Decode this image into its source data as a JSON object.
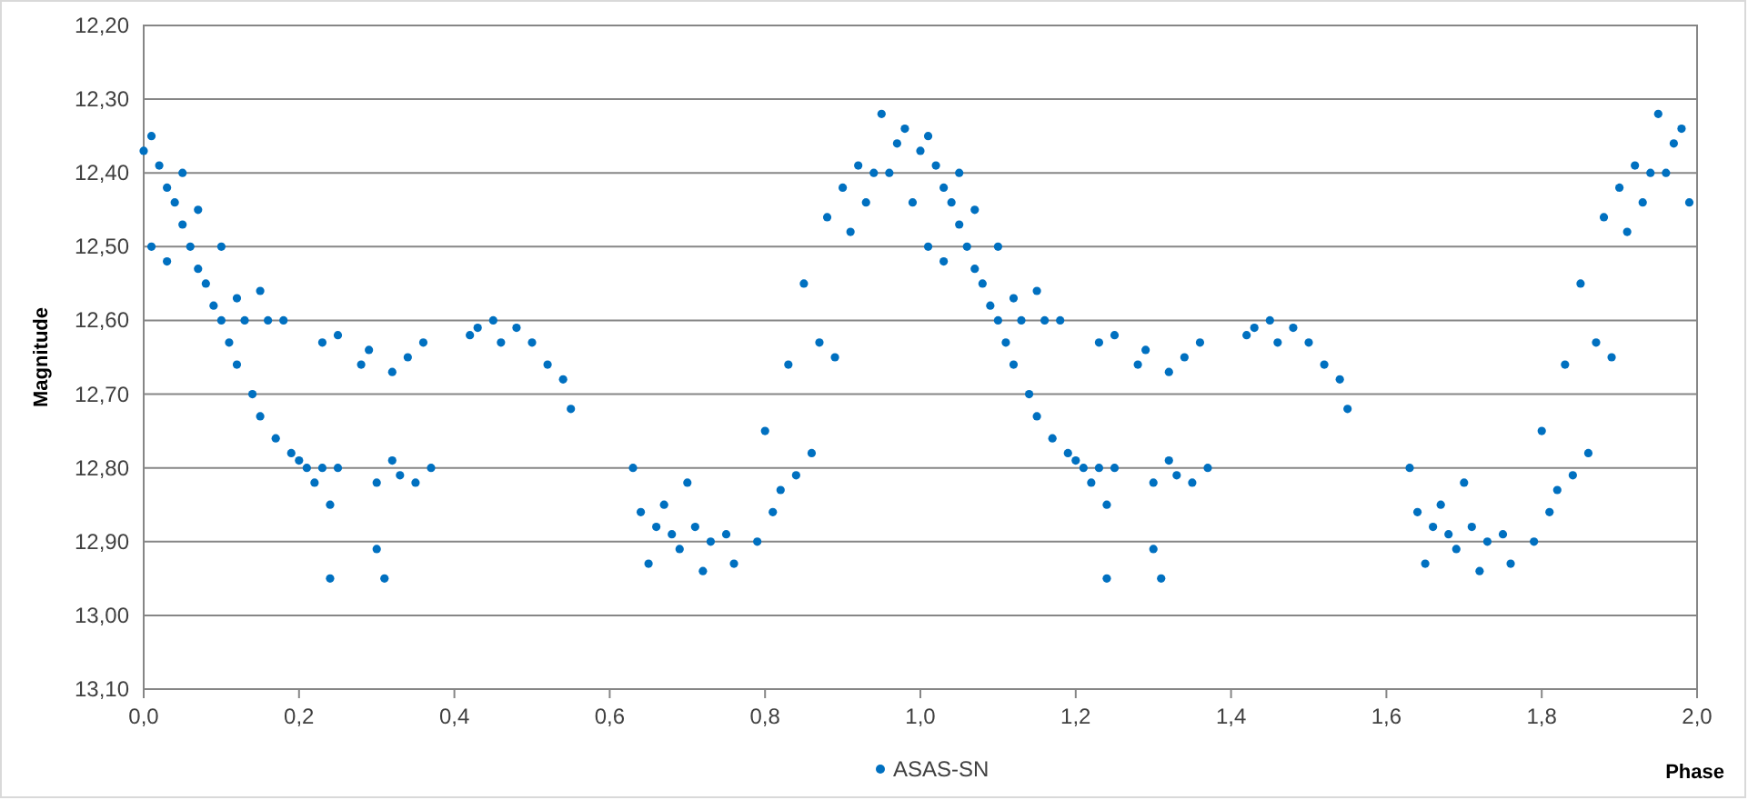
{
  "chart_data": {
    "type": "scatter",
    "grid": "y",
    "xlabel": "Phase",
    "ylabel": "Magnitude",
    "xlim": [
      0,
      2
    ],
    "ylim": [
      13.1,
      12.2
    ],
    "xticks": [
      {
        "value": 0,
        "label": "0,0"
      },
      {
        "value": 0.2,
        "label": "0,2"
      },
      {
        "value": 0.4,
        "label": "0,4"
      },
      {
        "value": 0.6,
        "label": "0,6"
      },
      {
        "value": 0.8,
        "label": "0,8"
      },
      {
        "value": 1,
        "label": "1,0"
      },
      {
        "value": 1.2,
        "label": "1,2"
      },
      {
        "value": 1.4,
        "label": "1,4"
      },
      {
        "value": 1.6,
        "label": "1,6"
      },
      {
        "value": 1.8,
        "label": "1,8"
      },
      {
        "value": 2,
        "label": "2,0"
      }
    ],
    "yticks": [
      {
        "value": 12.2,
        "label": "12,20"
      },
      {
        "value": 12.3,
        "label": "12,30"
      },
      {
        "value": 12.4,
        "label": "12,40"
      },
      {
        "value": 12.5,
        "label": "12,50"
      },
      {
        "value": 12.6,
        "label": "12,60"
      },
      {
        "value": 12.7,
        "label": "12,70"
      },
      {
        "value": 12.8,
        "label": "12,80"
      },
      {
        "value": 12.9,
        "label": "12,90"
      },
      {
        "value": 13,
        "label": "13,00"
      },
      {
        "value": 13.1,
        "label": "13,10"
      }
    ],
    "x": [
      0,
      0.01,
      0.01,
      0.02,
      0.03,
      0.03,
      0.04,
      0.05,
      0.05,
      0.06,
      0.07,
      0.07,
      0.08,
      0.09,
      0.1,
      0.1,
      0.11,
      0.12,
      0.12,
      0.13,
      0.14,
      0.15,
      0.15,
      0.16,
      0.17,
      0.18,
      0.19,
      0.2,
      0.21,
      0.22,
      0.23,
      0.23,
      0.24,
      0.24,
      0.25,
      0.25,
      0.28,
      0.29,
      0.3,
      0.3,
      0.31,
      0.32,
      0.32,
      0.33,
      0.34,
      0.35,
      0.36,
      0.37,
      0.42,
      0.43,
      0.45,
      0.46,
      0.48,
      0.5,
      0.52,
      0.54,
      0.55,
      0.63,
      0.64,
      0.65,
      0.66,
      0.67,
      0.68,
      0.69,
      0.7,
      0.71,
      0.72,
      0.73,
      0.75,
      0.76,
      0.79,
      0.8,
      0.81,
      0.82,
      0.83,
      0.84,
      0.85,
      0.86,
      0.87,
      0.88,
      0.89,
      0.9,
      0.91,
      0.92,
      0.93,
      0.94,
      0.95,
      0.96,
      0.97,
      0.98,
      0.99,
      1,
      1.01,
      1.01,
      1.02,
      1.03,
      1.03,
      1.04,
      1.05,
      1.05,
      1.06,
      1.07,
      1.07,
      1.08,
      1.09,
      1.1,
      1.1,
      1.11,
      1.12,
      1.12,
      1.13,
      1.14,
      1.15,
      1.15,
      1.16,
      1.17,
      1.18,
      1.19,
      1.2,
      1.21,
      1.22,
      1.23,
      1.23,
      1.24,
      1.24,
      1.25,
      1.25,
      1.28,
      1.29,
      1.3,
      1.3,
      1.31,
      1.32,
      1.32,
      1.33,
      1.34,
      1.35,
      1.36,
      1.37,
      1.42,
      1.43,
      1.45,
      1.46,
      1.48,
      1.5,
      1.52,
      1.54,
      1.55,
      1.63,
      1.64,
      1.65,
      1.66,
      1.67,
      1.68,
      1.69,
      1.7,
      1.71,
      1.72,
      1.73,
      1.75,
      1.76,
      1.79,
      1.8,
      1.81,
      1.82,
      1.83,
      1.84,
      1.85,
      1.86,
      1.87,
      1.88,
      1.89,
      1.9,
      1.91,
      1.92,
      1.93,
      1.94,
      1.95,
      1.96,
      1.97,
      1.98,
      1.99
    ],
    "series": [
      {
        "name": "ASAS-SN",
        "color": "#0070c0",
        "values": [
          12.37,
          12.35,
          12.5,
          12.39,
          12.42,
          12.52,
          12.44,
          12.47,
          12.4,
          12.5,
          12.53,
          12.45,
          12.55,
          12.58,
          12.6,
          12.5,
          12.63,
          12.66,
          12.57,
          12.6,
          12.7,
          12.73,
          12.56,
          12.6,
          12.76,
          12.6,
          12.78,
          12.79,
          12.8,
          12.82,
          12.8,
          12.63,
          12.85,
          12.95,
          12.8,
          12.62,
          12.66,
          12.64,
          12.82,
          12.91,
          12.95,
          12.67,
          12.79,
          12.81,
          12.65,
          12.82,
          12.63,
          12.8,
          12.62,
          12.61,
          12.6,
          12.63,
          12.61,
          12.63,
          12.66,
          12.68,
          12.72,
          12.8,
          12.86,
          12.93,
          12.88,
          12.85,
          12.89,
          12.91,
          12.82,
          12.88,
          12.94,
          12.9,
          12.89,
          12.93,
          12.9,
          12.75,
          12.86,
          12.83,
          12.66,
          12.81,
          12.55,
          12.78,
          12.63,
          12.46,
          12.65,
          12.42,
          12.48,
          12.39,
          12.44,
          12.4,
          12.32,
          12.4,
          12.36,
          12.34,
          12.44,
          12.37,
          12.35,
          12.5,
          12.39,
          12.42,
          12.52,
          12.44,
          12.47,
          12.4,
          12.5,
          12.53,
          12.45,
          12.55,
          12.58,
          12.6,
          12.5,
          12.63,
          12.66,
          12.57,
          12.6,
          12.7,
          12.73,
          12.56,
          12.6,
          12.76,
          12.6,
          12.78,
          12.79,
          12.8,
          12.82,
          12.8,
          12.63,
          12.85,
          12.95,
          12.8,
          12.62,
          12.66,
          12.64,
          12.82,
          12.91,
          12.95,
          12.67,
          12.79,
          12.81,
          12.65,
          12.82,
          12.63,
          12.8,
          12.62,
          12.61,
          12.6,
          12.63,
          12.61,
          12.63,
          12.66,
          12.68,
          12.72,
          12.8,
          12.86,
          12.93,
          12.88,
          12.85,
          12.89,
          12.91,
          12.82,
          12.88,
          12.94,
          12.9,
          12.89,
          12.93,
          12.9,
          12.75,
          12.86,
          12.83,
          12.66,
          12.81,
          12.55,
          12.78,
          12.63,
          12.46,
          12.65,
          12.42,
          12.48,
          12.39,
          12.44,
          12.4,
          12.32,
          12.4,
          12.36,
          12.34,
          12.44
        ]
      }
    ]
  }
}
